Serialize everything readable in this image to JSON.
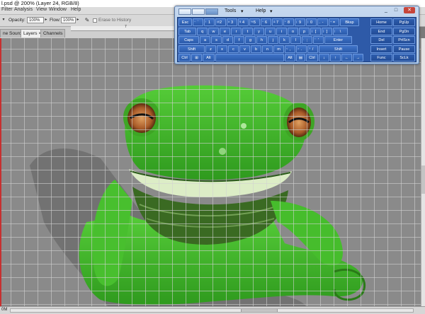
{
  "window": {
    "title": "l.psd @ 200% (Layer 24, RGB/8)"
  },
  "menu": [
    "Filter",
    "Analysis",
    "View",
    "Window",
    "Help"
  ],
  "options": {
    "opacity_label": "Opacity:",
    "opacity_value": "100%",
    "flow_label": "Flow:",
    "flow_value": "100%",
    "erase_history_label": "Erase to History"
  },
  "ruler": {
    "mark": "7"
  },
  "panel_tabs": [
    "ne Source",
    "Layers ×",
    "Channels"
  ],
  "status": {
    "zoom": "0M"
  },
  "osk": {
    "menus": [
      "Tools",
      "Help"
    ],
    "window_buttons": [
      "_",
      "□",
      "✕"
    ],
    "rows": [
      [
        {
          "label": "Esc"
        },
        {
          "label": "`",
          "sub": "~"
        },
        {
          "label": "1",
          "sub": "!"
        },
        {
          "label": "2",
          "sub": "@"
        },
        {
          "label": "3",
          "sub": "#"
        },
        {
          "label": "4",
          "sub": "$"
        },
        {
          "label": "5",
          "sub": "%"
        },
        {
          "label": "6",
          "sub": "^"
        },
        {
          "label": "7",
          "sub": "&"
        },
        {
          "label": "8",
          "sub": "*"
        },
        {
          "label": "9",
          "sub": "("
        },
        {
          "label": "0",
          "sub": ")"
        },
        {
          "label": "-",
          "sub": "_"
        },
        {
          "label": "=",
          "sub": "+"
        },
        {
          "label": "Bksp"
        }
      ],
      [
        {
          "label": "Tab"
        },
        {
          "label": "q"
        },
        {
          "label": "w"
        },
        {
          "label": "e"
        },
        {
          "label": "r"
        },
        {
          "label": "t"
        },
        {
          "label": "y"
        },
        {
          "label": "u"
        },
        {
          "label": "i"
        },
        {
          "label": "o"
        },
        {
          "label": "p"
        },
        {
          "label": "[",
          "sub": "{"
        },
        {
          "label": "]",
          "sub": "}"
        },
        {
          "label": "\\",
          "sub": "|"
        }
      ],
      [
        {
          "label": "Caps"
        },
        {
          "label": "a"
        },
        {
          "label": "s"
        },
        {
          "label": "d"
        },
        {
          "label": "f"
        },
        {
          "label": "g"
        },
        {
          "label": "h"
        },
        {
          "label": "j"
        },
        {
          "label": "k"
        },
        {
          "label": "l"
        },
        {
          "label": ";",
          "sub": ":"
        },
        {
          "label": "'",
          "sub": "\""
        },
        {
          "label": "Enter"
        }
      ],
      [
        {
          "label": "Shift"
        },
        {
          "label": "z"
        },
        {
          "label": "x"
        },
        {
          "label": "c"
        },
        {
          "label": "v"
        },
        {
          "label": "b"
        },
        {
          "label": "n"
        },
        {
          "label": "m"
        },
        {
          "label": ",",
          "sub": "<"
        },
        {
          "label": ".",
          "sub": ">"
        },
        {
          "label": "/",
          "sub": "?"
        },
        {
          "label": "Shift"
        }
      ],
      [
        {
          "label": "Ctrl"
        },
        {
          "label": "⊞"
        },
        {
          "label": "Alt"
        },
        {
          "label": ""
        },
        {
          "label": "Alt"
        },
        {
          "label": "▤"
        },
        {
          "label": "Ctrl"
        },
        {
          "label": "↓"
        },
        {
          "label": "↑"
        },
        {
          "label": "←"
        },
        {
          "label": "→"
        }
      ]
    ],
    "side_keys": [
      [
        "Home",
        "PgUp"
      ],
      [
        "End",
        "PgDn"
      ],
      [
        "Del",
        "PrtScn"
      ],
      [
        "Insert",
        "Pause"
      ],
      [
        "Func",
        "ScLk"
      ]
    ]
  },
  "colors": {
    "accent": "#2e5aa8",
    "frog_green": "#3fb82c",
    "canvas_bg": "#8a8a8a"
  }
}
